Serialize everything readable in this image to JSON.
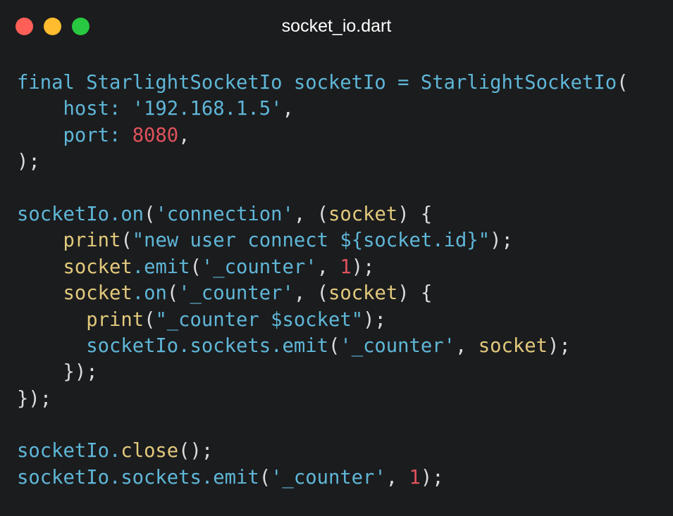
{
  "window": {
    "title": "socket_io.dart",
    "controls": [
      {
        "name": "close-button",
        "color": "#fe5f57"
      },
      {
        "name": "minimize-button",
        "color": "#febc2e"
      },
      {
        "name": "zoom-button",
        "color": "#28c840"
      }
    ]
  },
  "colors": {
    "background": "#1b1c1e",
    "plain": "#dcdcdc",
    "identifier": "#5fb7d8",
    "call": "#e2c97c",
    "string": "#5fb7d8",
    "number": "#e0525d"
  },
  "code": {
    "lines": [
      [
        {
          "text": "final StarlightSocketIo socketIo = StarlightSocketIo",
          "kind": "identifier"
        },
        {
          "text": "(",
          "kind": "plain"
        }
      ],
      [
        {
          "text": "    host: ",
          "kind": "identifier"
        },
        {
          "text": "'192.168.1.5'",
          "kind": "string"
        },
        {
          "text": ",",
          "kind": "plain"
        }
      ],
      [
        {
          "text": "    port: ",
          "kind": "identifier"
        },
        {
          "text": "8080",
          "kind": "number"
        },
        {
          "text": ",",
          "kind": "plain"
        }
      ],
      [
        {
          "text": ");",
          "kind": "plain"
        }
      ],
      [],
      [
        {
          "text": "socketIo.on",
          "kind": "identifier"
        },
        {
          "text": "(",
          "kind": "plain"
        },
        {
          "text": "'connection'",
          "kind": "string"
        },
        {
          "text": ", (",
          "kind": "plain"
        },
        {
          "text": "socket",
          "kind": "call"
        },
        {
          "text": ") {",
          "kind": "plain"
        }
      ],
      [
        {
          "text": "    ",
          "kind": "plain"
        },
        {
          "text": "print",
          "kind": "call"
        },
        {
          "text": "(",
          "kind": "plain"
        },
        {
          "text": "\"new user connect ${socket.id}\"",
          "kind": "string"
        },
        {
          "text": ");",
          "kind": "plain"
        }
      ],
      [
        {
          "text": "    ",
          "kind": "plain"
        },
        {
          "text": "socket",
          "kind": "call"
        },
        {
          "text": ".emit",
          "kind": "identifier"
        },
        {
          "text": "(",
          "kind": "plain"
        },
        {
          "text": "'_counter'",
          "kind": "string"
        },
        {
          "text": ", ",
          "kind": "plain"
        },
        {
          "text": "1",
          "kind": "number"
        },
        {
          "text": ");",
          "kind": "plain"
        }
      ],
      [
        {
          "text": "    ",
          "kind": "plain"
        },
        {
          "text": "socket",
          "kind": "call"
        },
        {
          "text": ".on",
          "kind": "identifier"
        },
        {
          "text": "(",
          "kind": "plain"
        },
        {
          "text": "'_counter'",
          "kind": "string"
        },
        {
          "text": ", (",
          "kind": "plain"
        },
        {
          "text": "socket",
          "kind": "call"
        },
        {
          "text": ") {",
          "kind": "plain"
        }
      ],
      [
        {
          "text": "      ",
          "kind": "plain"
        },
        {
          "text": "print",
          "kind": "call"
        },
        {
          "text": "(",
          "kind": "plain"
        },
        {
          "text": "\"_counter $socket\"",
          "kind": "string"
        },
        {
          "text": ");",
          "kind": "plain"
        }
      ],
      [
        {
          "text": "      ",
          "kind": "plain"
        },
        {
          "text": "socketIo.sockets.emit",
          "kind": "identifier"
        },
        {
          "text": "(",
          "kind": "plain"
        },
        {
          "text": "'_counter'",
          "kind": "string"
        },
        {
          "text": ", ",
          "kind": "plain"
        },
        {
          "text": "socket",
          "kind": "call"
        },
        {
          "text": ");",
          "kind": "plain"
        }
      ],
      [
        {
          "text": "    });",
          "kind": "plain"
        }
      ],
      [
        {
          "text": "});",
          "kind": "plain"
        }
      ],
      [],
      [
        {
          "text": "socketIo.",
          "kind": "identifier"
        },
        {
          "text": "close",
          "kind": "call"
        },
        {
          "text": "();",
          "kind": "plain"
        }
      ],
      [
        {
          "text": "socketIo.sockets.emit",
          "kind": "identifier"
        },
        {
          "text": "(",
          "kind": "plain"
        },
        {
          "text": "'_counter'",
          "kind": "string"
        },
        {
          "text": ", ",
          "kind": "plain"
        },
        {
          "text": "1",
          "kind": "number"
        },
        {
          "text": ");",
          "kind": "plain"
        }
      ]
    ]
  }
}
